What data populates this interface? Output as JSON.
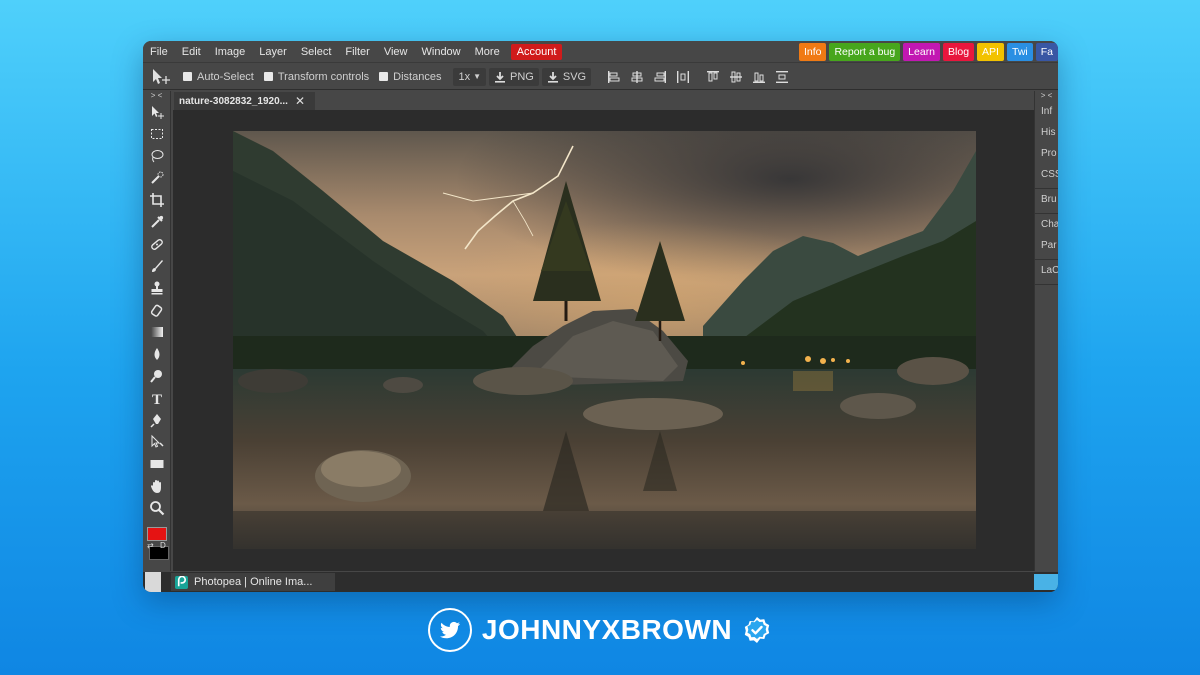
{
  "menubar": {
    "items": [
      "File",
      "Edit",
      "Image",
      "Layer",
      "Select",
      "Filter",
      "View",
      "Window",
      "More"
    ],
    "account_label": "Account",
    "ext_links": [
      {
        "label": "Info",
        "color": "#f07a14"
      },
      {
        "label": "Report a bug",
        "color": "#47a61c"
      },
      {
        "label": "Learn",
        "color": "#c218b2"
      },
      {
        "label": "Blog",
        "color": "#e8173d"
      },
      {
        "label": "API",
        "color": "#f2c200"
      },
      {
        "label": "Twi",
        "color": "#2a8fe3"
      },
      {
        "label": "Fa",
        "color": "#3957a4"
      }
    ]
  },
  "options": {
    "auto_select": "Auto-Select",
    "transform_controls": "Transform controls",
    "distances": "Distances",
    "zoom": "1x",
    "png": "PNG",
    "svg": "SVG"
  },
  "toolbar": {
    "collapse": "> <",
    "tools": [
      "move-tool-icon",
      "marquee-tool-icon",
      "lasso-tool-icon",
      "quick-select-icon",
      "crop-tool-icon",
      "eyedropper-icon",
      "healing-brush-icon",
      "brush-tool-icon",
      "clone-stamp-icon",
      "eraser-icon",
      "gradient-tool-icon",
      "blur-tool-icon",
      "dodge-tool-icon",
      "type-tool-icon",
      "pen-tool-icon",
      "path-select-icon",
      "shape-tool-icon",
      "hand-tool-icon",
      "zoom-tool-icon"
    ],
    "foreground_color": "#e51313",
    "background_color": "#000000",
    "swap_symbol": "⇄",
    "default_symbol": "D"
  },
  "document": {
    "tab_title": "nature-3082832_1920...",
    "close_symbol": "✕"
  },
  "right_panel": {
    "collapse": "> <",
    "groups": [
      [
        "Inf",
        "His",
        "Pro",
        "CSS"
      ],
      [
        "Bru"
      ],
      [
        "Cha",
        "Par"
      ],
      [
        "LaC"
      ]
    ]
  },
  "taskbar": {
    "item_label": "Photopea | Online Ima..."
  },
  "footer": {
    "handle": "JOHNNYXBROWN"
  }
}
